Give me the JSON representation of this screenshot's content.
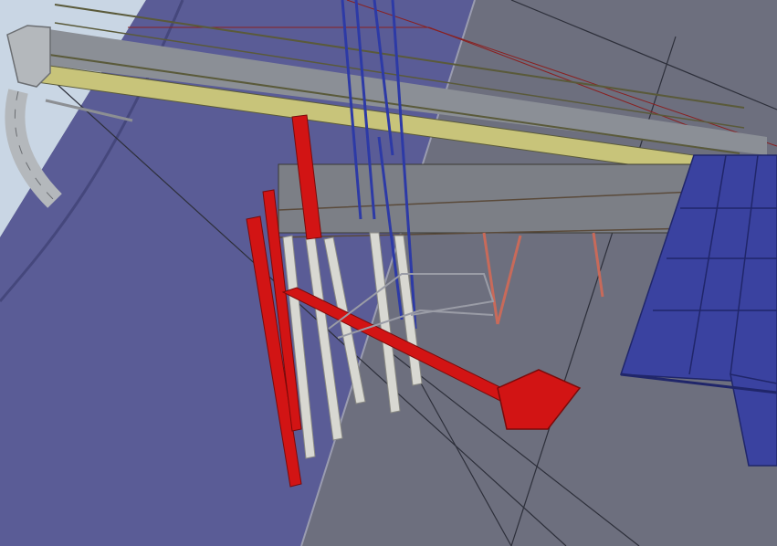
{
  "scene": {
    "subject": "3d-cad-render-ship-loader",
    "colors": {
      "sky": "#c9d6e4",
      "hull_blue": "#5a5c96",
      "hull_blue_dark": "#45477c",
      "deck_gray": "#6d6f7e",
      "steel_gray": "#7c7f86",
      "conveyor_top": "#8b8f96",
      "belt_olive": "#c8c47a",
      "railing": "#5a5a3a",
      "fender_red": "#d21414",
      "spout_gray": "#b4b8bc",
      "tower_blue": "#2d3aa6",
      "panel_blue": "#3a42a0",
      "pile_white": "#d8d8d2",
      "brace_salmon": "#c86a5a"
    }
  }
}
